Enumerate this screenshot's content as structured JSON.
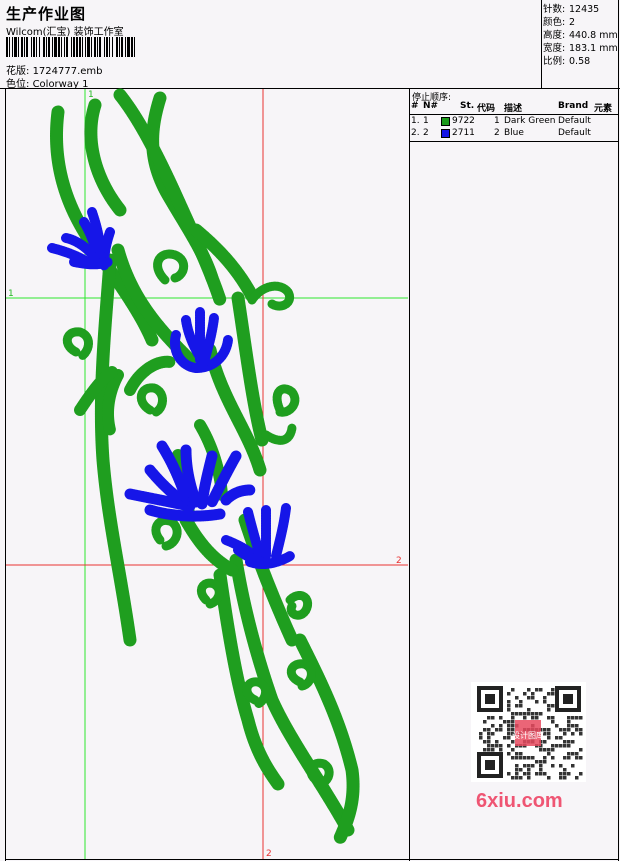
{
  "header": {
    "title": "生产作业图",
    "studio": "Wilcom(汇宝) 装饰工作室",
    "pattern_label": "花版:",
    "pattern_file": "1724777.emb",
    "colorway_label": "色位:",
    "colorway": "Colorway 1"
  },
  "stats": [
    {
      "label": "针数:",
      "value": "12435"
    },
    {
      "label": "颜色:",
      "value": "2"
    },
    {
      "label": "高度:",
      "value": "440.8 mm"
    },
    {
      "label": "宽度:",
      "value": "183.1 mm"
    },
    {
      "label": "比例:",
      "value": "0.58"
    }
  ],
  "stop_order": {
    "title": "停止顺序:",
    "columns": [
      "#",
      "N#",
      "St.",
      "代码",
      "描述",
      "Brand",
      "元素"
    ],
    "rows": [
      {
        "index": "1.",
        "num": "1",
        "code": "9722",
        "stitch": "1",
        "desc": "Dark Green",
        "brand": "Default",
        "color": "#1a9a1a"
      },
      {
        "index": "2.",
        "num": "2",
        "code": "2711",
        "stitch": "2",
        "desc": "Blue",
        "brand": "Default",
        "color": "#1414e6"
      }
    ]
  },
  "guides": {
    "h1": "1",
    "h2": "2",
    "v1": "1",
    "v2": "2"
  },
  "watermark": {
    "text": "6xiu.com",
    "seal_text": "设计图库"
  },
  "colors": {
    "green": "#1f9e1f",
    "blue": "#1616e8",
    "guide_green": "#2ee82e",
    "guide_red": "#e83232"
  }
}
